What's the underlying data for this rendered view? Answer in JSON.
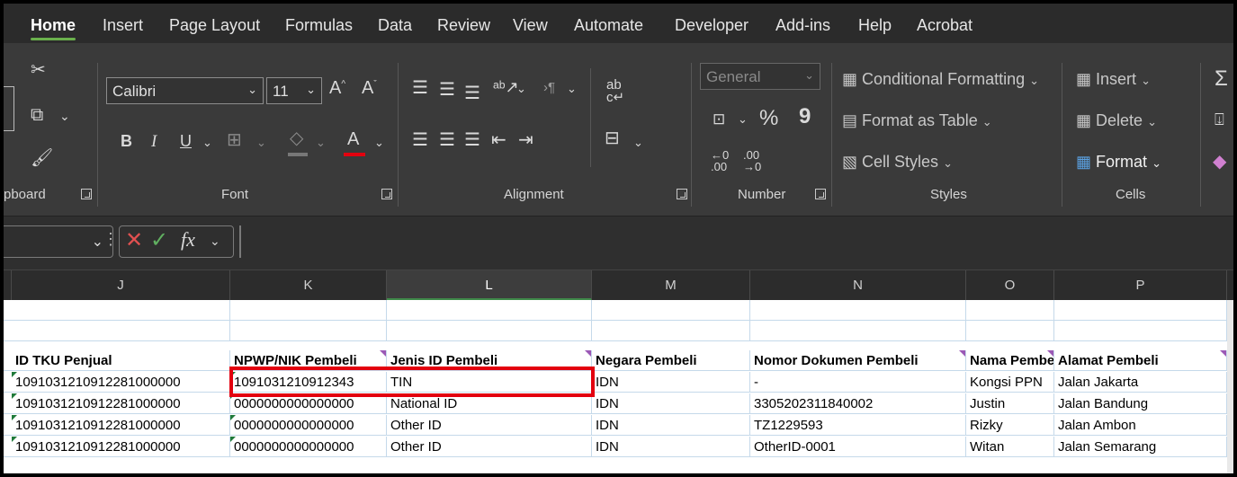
{
  "tabs": [
    "Home",
    "Insert",
    "Page Layout",
    "Formulas",
    "Data",
    "Review",
    "View",
    "Automate",
    "Developer",
    "Add-ins",
    "Help",
    "Acrobat"
  ],
  "ribbon": {
    "clipboard": {
      "label": "pboard"
    },
    "font": {
      "family": "Calibri",
      "size": "11",
      "bold": "B",
      "italic": "I",
      "underline": "U",
      "label": "Font"
    },
    "alignment": {
      "label": "Alignment"
    },
    "number": {
      "format": "General",
      "percent": "%",
      "comma": "9",
      "label": "Number"
    },
    "styles": {
      "conditional": "Conditional Formatting",
      "table": "Format as Table",
      "cell_styles": "Cell Styles",
      "label": "Styles"
    },
    "cells": {
      "insert": "Insert",
      "delete": "Delete",
      "format": "Format",
      "label": "Cells"
    }
  },
  "formula_bar": {
    "fx": "fx",
    "value": ""
  },
  "columns": [
    {
      "letter": "J",
      "selected": false
    },
    {
      "letter": "K",
      "selected": false
    },
    {
      "letter": "L",
      "selected": true
    },
    {
      "letter": "M",
      "selected": false
    },
    {
      "letter": "N",
      "selected": false
    },
    {
      "letter": "O",
      "selected": false
    },
    {
      "letter": "P",
      "selected": false
    }
  ],
  "headers": [
    "ID TKU Penjual",
    "NPWP/NIK Pembeli",
    "Jenis ID Pembeli",
    "Negara Pembeli",
    "Nomor Dokumen Pembeli",
    "Nama Pembeli",
    "Alamat Pembeli"
  ],
  "rows": [
    [
      "1091031210912281000000",
      "1091031210912343",
      "TIN",
      "IDN",
      "-",
      "Kongsi PPN",
      "Jalan Jakarta"
    ],
    [
      "1091031210912281000000",
      "0000000000000000",
      "National ID",
      "IDN",
      "3305202311840002",
      "Justin",
      "Jalan Bandung"
    ],
    [
      "1091031210912281000000",
      "0000000000000000",
      "Other ID",
      "IDN",
      "TZ1229593",
      "Rizky",
      "Jalan Ambon"
    ],
    [
      "1091031210912281000000",
      "0000000000000000",
      "Other ID",
      "IDN",
      "OtherID-0001",
      "Witan",
      "Jalan Semarang"
    ]
  ],
  "colors": {
    "accent": "#3f8a4a",
    "highlight": "#e3000f",
    "font_color_bar": "#e3000f"
  }
}
